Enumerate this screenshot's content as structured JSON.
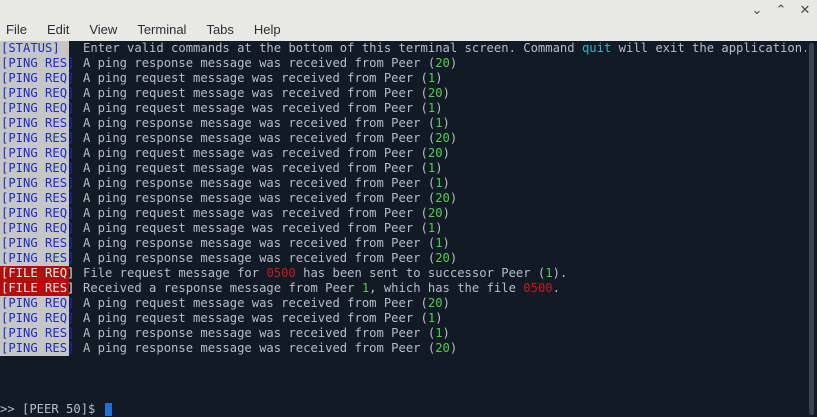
{
  "window": {
    "controls": [
      "⌄",
      "⌃",
      "✕"
    ]
  },
  "menubar": {
    "items": [
      "File",
      "Edit",
      "View",
      "Terminal",
      "Tabs",
      "Help"
    ]
  },
  "terminal": {
    "lines": [
      {
        "tag": "[STATUS]",
        "kind": "status",
        "parts": [
          {
            "t": "Enter valid commands at the bottom of this terminal screen. Command ",
            "c": ""
          },
          {
            "t": "quit",
            "c": "cyan"
          },
          {
            "t": " will exit the application.",
            "c": ""
          }
        ]
      },
      {
        "tag": "[PING RES]",
        "kind": "ping",
        "parts": [
          {
            "t": "A ping response message was received from Peer (",
            "c": ""
          },
          {
            "t": "20",
            "c": "green"
          },
          {
            "t": ")",
            "c": ""
          }
        ]
      },
      {
        "tag": "[PING REQ]",
        "kind": "ping",
        "parts": [
          {
            "t": "A ping request message was received from Peer (",
            "c": ""
          },
          {
            "t": "1",
            "c": "green"
          },
          {
            "t": ")",
            "c": ""
          }
        ]
      },
      {
        "tag": "[PING REQ]",
        "kind": "ping",
        "parts": [
          {
            "t": "A ping request message was received from Peer (",
            "c": ""
          },
          {
            "t": "20",
            "c": "green"
          },
          {
            "t": ")",
            "c": ""
          }
        ]
      },
      {
        "tag": "[PING REQ]",
        "kind": "ping",
        "parts": [
          {
            "t": "A ping request message was received from Peer (",
            "c": ""
          },
          {
            "t": "1",
            "c": "green"
          },
          {
            "t": ")",
            "c": ""
          }
        ]
      },
      {
        "tag": "[PING RES]",
        "kind": "ping",
        "parts": [
          {
            "t": "A ping response message was received from Peer (",
            "c": ""
          },
          {
            "t": "1",
            "c": "green"
          },
          {
            "t": ")",
            "c": ""
          }
        ]
      },
      {
        "tag": "[PING RES]",
        "kind": "ping",
        "parts": [
          {
            "t": "A ping response message was received from Peer (",
            "c": ""
          },
          {
            "t": "20",
            "c": "green"
          },
          {
            "t": ")",
            "c": ""
          }
        ]
      },
      {
        "tag": "[PING REQ]",
        "kind": "ping",
        "parts": [
          {
            "t": "A ping request message was received from Peer (",
            "c": ""
          },
          {
            "t": "20",
            "c": "green"
          },
          {
            "t": ")",
            "c": ""
          }
        ]
      },
      {
        "tag": "[PING REQ]",
        "kind": "ping",
        "parts": [
          {
            "t": "A ping request message was received from Peer (",
            "c": ""
          },
          {
            "t": "1",
            "c": "green"
          },
          {
            "t": ")",
            "c": ""
          }
        ]
      },
      {
        "tag": "[PING RES]",
        "kind": "ping",
        "parts": [
          {
            "t": "A ping response message was received from Peer (",
            "c": ""
          },
          {
            "t": "1",
            "c": "green"
          },
          {
            "t": ")",
            "c": ""
          }
        ]
      },
      {
        "tag": "[PING RES]",
        "kind": "ping",
        "parts": [
          {
            "t": "A ping response message was received from Peer (",
            "c": ""
          },
          {
            "t": "20",
            "c": "green"
          },
          {
            "t": ")",
            "c": ""
          }
        ]
      },
      {
        "tag": "[PING REQ]",
        "kind": "ping",
        "parts": [
          {
            "t": "A ping request message was received from Peer (",
            "c": ""
          },
          {
            "t": "20",
            "c": "green"
          },
          {
            "t": ")",
            "c": ""
          }
        ]
      },
      {
        "tag": "[PING REQ]",
        "kind": "ping",
        "parts": [
          {
            "t": "A ping request message was received from Peer (",
            "c": ""
          },
          {
            "t": "1",
            "c": "green"
          },
          {
            "t": ")",
            "c": ""
          }
        ]
      },
      {
        "tag": "[PING RES]",
        "kind": "ping",
        "parts": [
          {
            "t": "A ping response message was received from Peer (",
            "c": ""
          },
          {
            "t": "1",
            "c": "green"
          },
          {
            "t": ")",
            "c": ""
          }
        ]
      },
      {
        "tag": "[PING RES]",
        "kind": "ping",
        "parts": [
          {
            "t": "A ping response message was received from Peer (",
            "c": ""
          },
          {
            "t": "20",
            "c": "green"
          },
          {
            "t": ")",
            "c": ""
          }
        ]
      },
      {
        "tag": "[FILE REQ]",
        "kind": "file",
        "parts": [
          {
            "t": "File request message for ",
            "c": ""
          },
          {
            "t": "0500",
            "c": "red"
          },
          {
            "t": " has been sent to successor Peer (",
            "c": ""
          },
          {
            "t": "1",
            "c": "green"
          },
          {
            "t": ").",
            "c": ""
          }
        ]
      },
      {
        "tag": "[FILE RES]",
        "kind": "file",
        "parts": [
          {
            "t": "Received a response message from Peer ",
            "c": ""
          },
          {
            "t": "1",
            "c": "green"
          },
          {
            "t": ", which has the file ",
            "c": ""
          },
          {
            "t": "0500",
            "c": "red"
          },
          {
            "t": ".",
            "c": ""
          }
        ]
      },
      {
        "tag": "[PING REQ]",
        "kind": "ping",
        "parts": [
          {
            "t": "A ping request message was received from Peer (",
            "c": ""
          },
          {
            "t": "20",
            "c": "green"
          },
          {
            "t": ")",
            "c": ""
          }
        ]
      },
      {
        "tag": "[PING REQ]",
        "kind": "ping",
        "parts": [
          {
            "t": "A ping request message was received from Peer (",
            "c": ""
          },
          {
            "t": "1",
            "c": "green"
          },
          {
            "t": ")",
            "c": ""
          }
        ]
      },
      {
        "tag": "[PING RES]",
        "kind": "ping",
        "parts": [
          {
            "t": "A ping response message was received from Peer (",
            "c": ""
          },
          {
            "t": "1",
            "c": "green"
          },
          {
            "t": ")",
            "c": ""
          }
        ]
      },
      {
        "tag": "[PING RES]",
        "kind": "ping",
        "parts": [
          {
            "t": "A ping response message was received from Peer (",
            "c": ""
          },
          {
            "t": "20",
            "c": "green"
          },
          {
            "t": ")",
            "c": ""
          }
        ]
      }
    ],
    "prompt": ">> [PEER 50]$ "
  },
  "colors": {
    "terminal_bg": "#121a26",
    "text": "#b9bdc3",
    "ping_tag_fg": "#1d2bc6",
    "tag_bg": "#c6c6c6",
    "file_tag_bg": "#b50d0d",
    "green": "#4ad14a",
    "cyan": "#2fb8c6",
    "red": "#c21c1c",
    "cursor": "#1e6fd9"
  }
}
